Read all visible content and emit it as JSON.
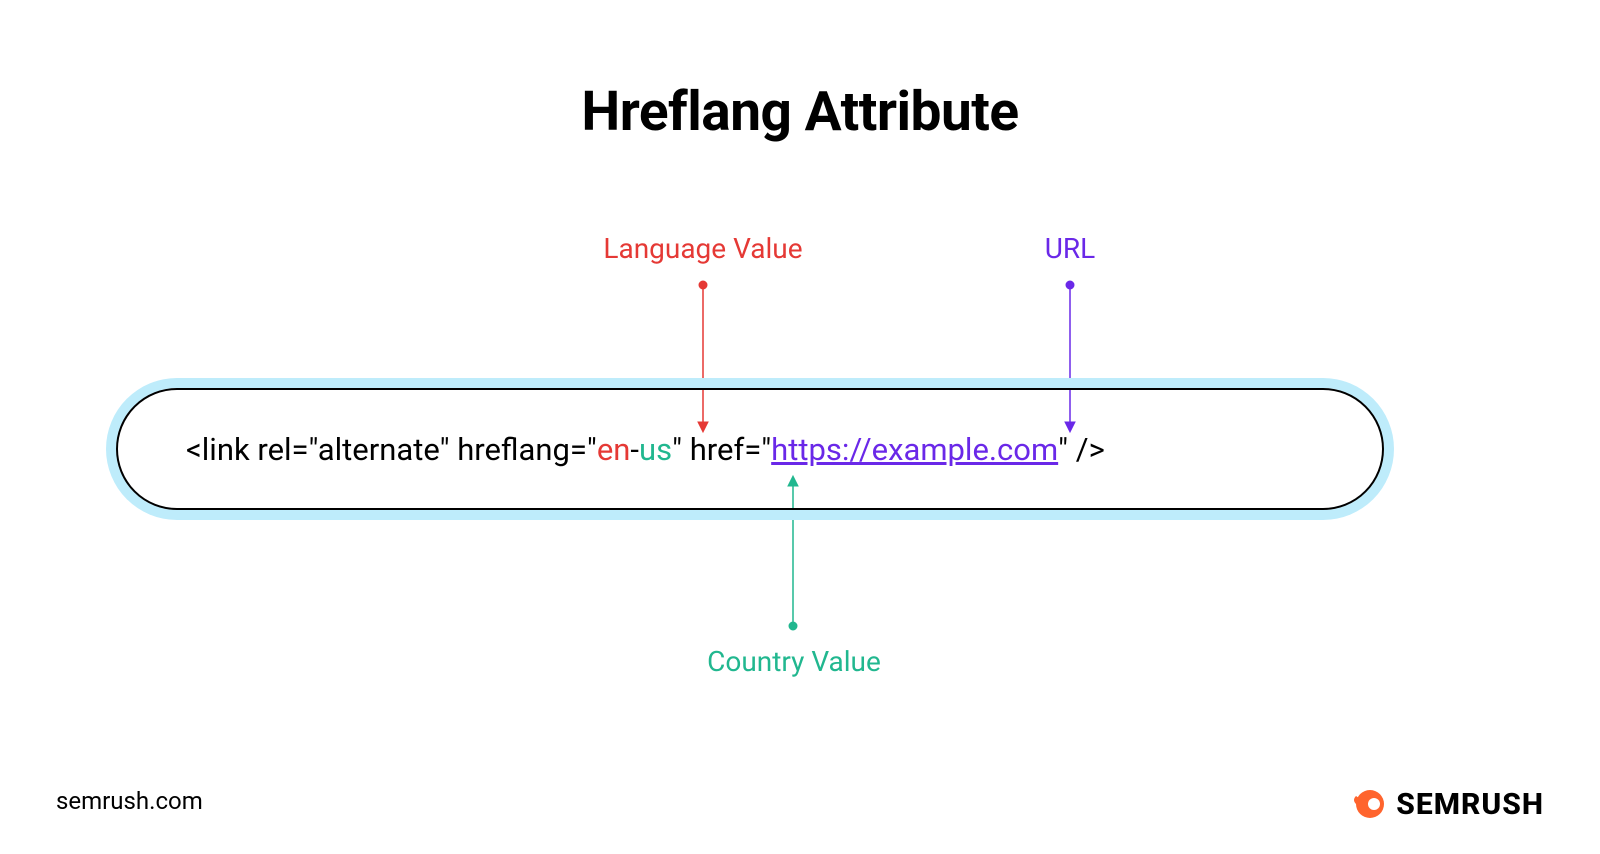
{
  "title": "Hreflang Attribute",
  "labels": {
    "language": "Language Value",
    "url": "URL",
    "country": "Country Value"
  },
  "code": {
    "prefix": "<link rel=\"alternate\" hreflang=\"",
    "lang": "en",
    "sep": "-",
    "country": "us",
    "mid": "\" href=\"",
    "url": "https://example.com",
    "suffix": "\" />"
  },
  "footer_url": "semrush.com",
  "brand": "SEMRUSH",
  "colors": {
    "lang": "#E53935",
    "country": "#21B78F",
    "url": "#6A28E8",
    "box_halo": "#BEECFB",
    "brand": "#FF642D"
  }
}
